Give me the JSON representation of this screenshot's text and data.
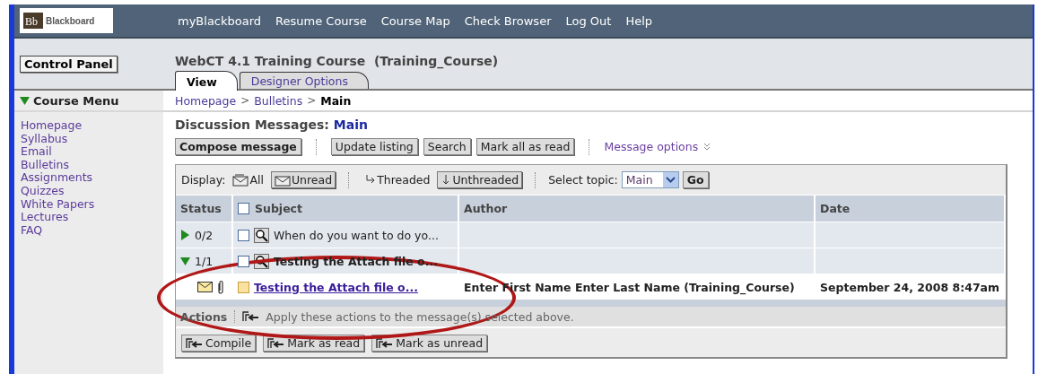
{
  "nav": {
    "logo_mark": "Bb",
    "logo": "Blackboard",
    "links": [
      "myBlackboard",
      "Resume Course",
      "Course Map",
      "Check Browser",
      "Log Out",
      "Help"
    ]
  },
  "control_panel": "Control Panel",
  "course": {
    "title": "WebCT 4.1 Training Course  (Training_Course)",
    "tabs": [
      {
        "label": "View",
        "selected": true
      },
      {
        "label": "Designer Options",
        "selected": false
      }
    ]
  },
  "course_menu": {
    "title": "Course Menu",
    "expanded": true,
    "items": [
      "Homepage",
      "Syllabus",
      "Email",
      "Bulletins",
      "Assignments",
      "Quizzes",
      "White Papers",
      "Lectures",
      "FAQ"
    ]
  },
  "breadcrumb": [
    {
      "kind": "link",
      "label": "Homepage"
    },
    {
      "kind": "separator",
      "label": ">"
    },
    {
      "kind": "link",
      "label": "Bulletins"
    },
    {
      "kind": "separator",
      "label": ">"
    },
    {
      "kind": "current",
      "label": "Main"
    }
  ],
  "heading": {
    "label": "Discussion Messages:",
    "topic": "Main"
  },
  "toolbar": {
    "buttons": [
      {
        "label": "Compose message",
        "primary": true
      },
      {
        "label": "Update listing",
        "primary": false
      },
      {
        "label": "Search",
        "primary": false
      },
      {
        "label": "Mark all as read",
        "primary": false
      }
    ],
    "menu": "Message options"
  },
  "display": {
    "label": "Display:",
    "filters": [
      {
        "label": "All",
        "selected": false
      },
      {
        "label": "Unread",
        "selected": true
      }
    ],
    "views": [
      {
        "label": "Threaded",
        "selected": false
      },
      {
        "label": "Unthreaded",
        "selected": true
      }
    ],
    "topic_label": "Select topic:",
    "topic_value": "Main",
    "go": "Go"
  },
  "table": {
    "columns": [
      "Status",
      "Subject",
      "Author",
      "Date"
    ],
    "select_all": false,
    "rows": [
      {
        "kind": "thread",
        "expanded": false,
        "count": "0/2",
        "checked": false,
        "subject": "When do you want to do yo..."
      },
      {
        "kind": "thread",
        "expanded": true,
        "count": "1/1",
        "checked": false,
        "subject": "Testing the Attach file o..."
      },
      {
        "kind": "message",
        "checked": false,
        "subject": "Testing the Attach file o...",
        "author": "Enter First Name Enter Last Name (Training_Course)",
        "date": "September 24, 2008 8:47am"
      }
    ]
  },
  "actions": {
    "label": "Actions",
    "hint": "Apply these actions to the message(s) selected above.",
    "buttons": [
      "Compile",
      "Mark as read",
      "Mark as unread"
    ]
  }
}
